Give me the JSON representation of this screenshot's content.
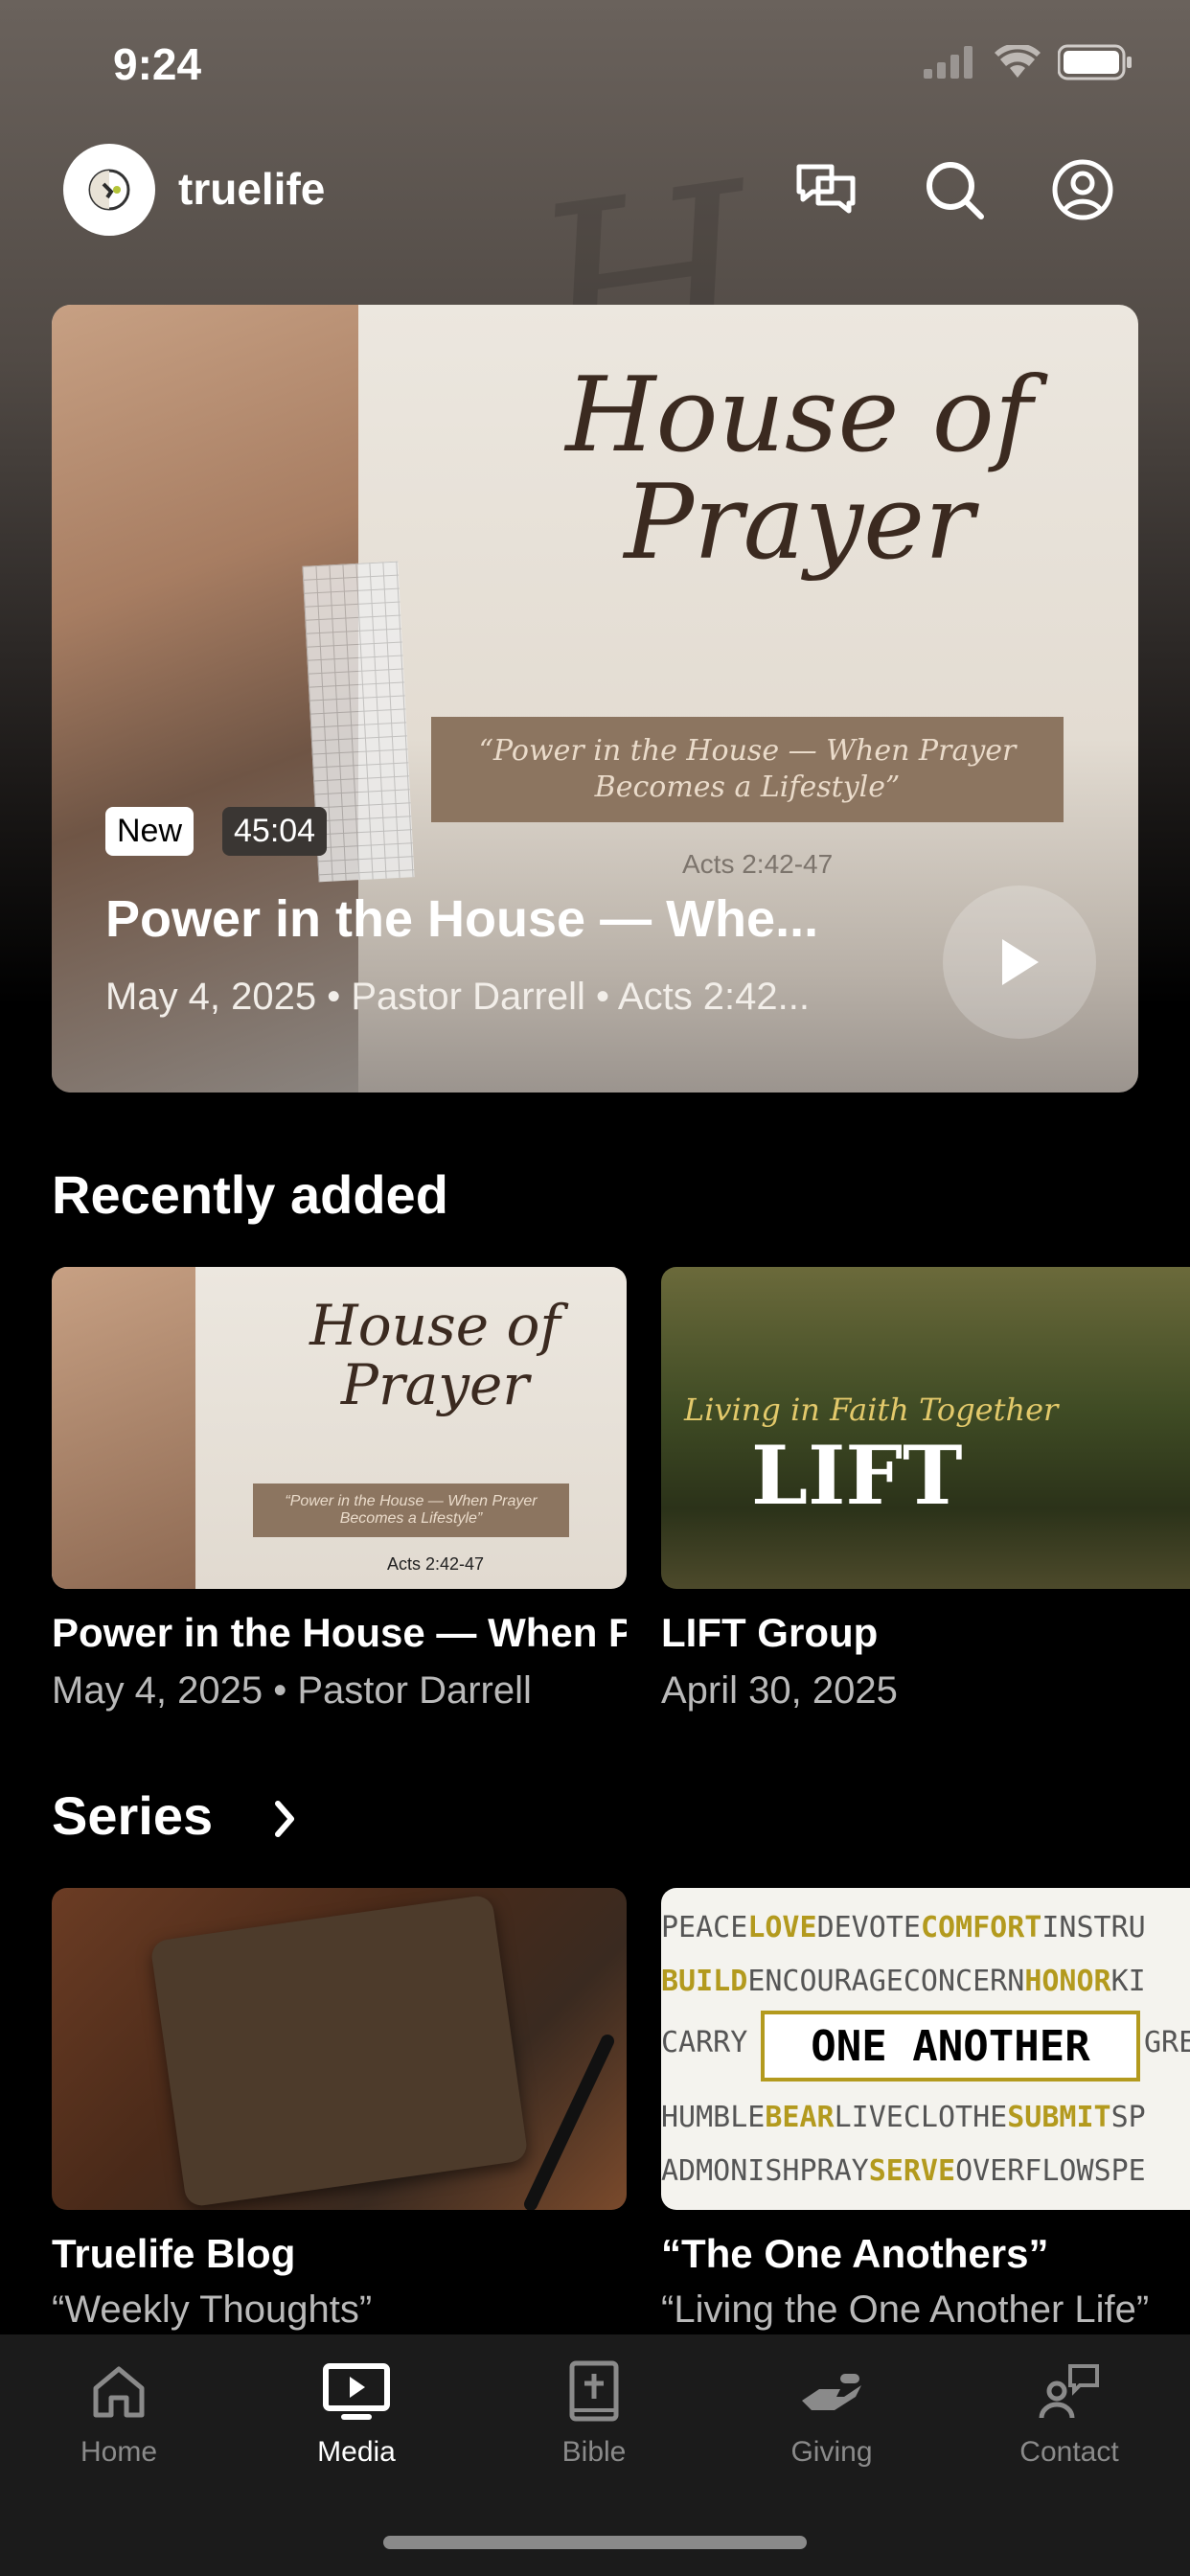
{
  "status_bar": {
    "time": "9:24"
  },
  "header": {
    "brand": "truelife"
  },
  "hero": {
    "artwork_title": "House of Prayer",
    "artwork_quote": "“Power in the House — When Prayer Becomes a Lifestyle”",
    "artwork_ref": "Acts 2:42-47",
    "badge_new": "New",
    "duration": "45:04",
    "title": "Power in the House — Whe...",
    "meta": "May 4, 2025 • Pastor Darrell • Acts 2:42..."
  },
  "recently_added": {
    "title": "Recently added",
    "items": [
      {
        "title": "Power in the House — When P",
        "subtitle": "May 4, 2025 • Pastor Darrell",
        "art_title": "House of Prayer",
        "art_quote": "“Power in the House — When Prayer Becomes a Lifestyle”",
        "art_ref": "Acts 2:42-47"
      },
      {
        "title": "LIFT Group",
        "subtitle": "April 30, 2025",
        "art_small": "Living in Faith Together",
        "art_big": "LIFT"
      }
    ]
  },
  "series": {
    "title": "Series",
    "items": [
      {
        "title": "Truelife Blog",
        "subtitle": "“Weekly Thoughts”"
      },
      {
        "title": "“The One Anothers”",
        "subtitle": "“Living the One Another Life”",
        "art_rows": [
          [
            "PEACE",
            "LOVE",
            "DEVOTE",
            "COMFORT",
            "INSTRU"
          ],
          [
            "BUILD",
            "ENCOURAGE",
            "CONCERN",
            "HONOR",
            "KI"
          ],
          [
            "HUMBLE",
            "BEAR",
            "LIVE",
            "CLOTHE",
            "SUBMIT",
            "SP"
          ],
          [
            "ADMONISH",
            "PRAY",
            "SERVE",
            "OVERFLOW",
            "SPE"
          ]
        ],
        "art_left": "CARRY",
        "art_center": "ONE ANOTHER",
        "art_right": "GRE"
      }
    ]
  },
  "tabbar": {
    "items": [
      {
        "label": "Home"
      },
      {
        "label": "Media"
      },
      {
        "label": "Bible"
      },
      {
        "label": "Giving"
      },
      {
        "label": "Contact"
      }
    ]
  }
}
